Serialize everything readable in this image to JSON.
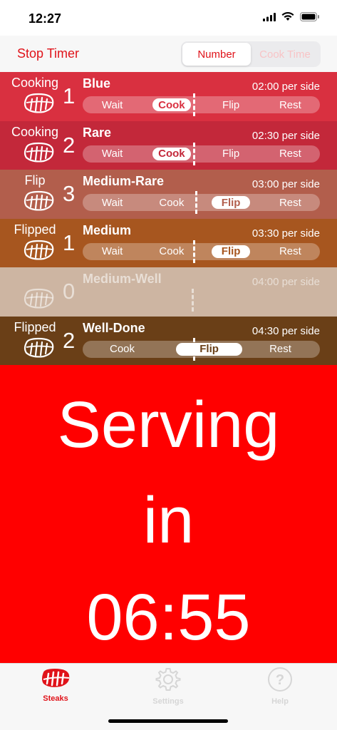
{
  "status_bar": {
    "time": "12:27"
  },
  "toolbar": {
    "stop_timer": "Stop Timer",
    "segments": [
      "Number",
      "Cook Time"
    ],
    "selected_segment": "Number"
  },
  "rows": [
    {
      "status": "Cooking",
      "count": "1",
      "name": "Blue",
      "time": "02:00 per side",
      "steps": [
        "Wait",
        "Cook",
        "Flip",
        "Rest"
      ],
      "active_step": "Cook",
      "color": "#d93040"
    },
    {
      "status": "Cooking",
      "count": "2",
      "name": "Rare",
      "time": "02:30 per side",
      "steps": [
        "Wait",
        "Cook",
        "Flip",
        "Rest"
      ],
      "active_step": "Cook",
      "color": "#c3283a"
    },
    {
      "status": "Flip",
      "count": "3",
      "name": "Medium-Rare",
      "time": "03:00 per side",
      "steps": [
        "Wait",
        "Cook",
        "Flip",
        "Rest"
      ],
      "active_step": "Flip",
      "color": "#b25e4c"
    },
    {
      "status": "Flipped",
      "count": "1",
      "name": "Medium",
      "time": "03:30 per side",
      "steps": [
        "Wait",
        "Cook",
        "Flip",
        "Rest"
      ],
      "active_step": "Flip",
      "color": "#a7561f"
    },
    {
      "status": "",
      "count": "0",
      "name": "Medium-Well",
      "time": "04:00 per side",
      "steps": [],
      "active_step": "",
      "color": "#cdb5a2"
    },
    {
      "status": "Flipped",
      "count": "2",
      "name": "Well-Done",
      "time": "04:30 per side",
      "steps": [
        "Cook",
        "Flip",
        "Rest"
      ],
      "active_step": "Flip",
      "color": "#6a3f17"
    }
  ],
  "serving": {
    "line1": "Serving",
    "line2": "in",
    "countdown": "06:55"
  },
  "tabs": [
    {
      "label": "Steaks",
      "icon": "steak-icon",
      "active": true
    },
    {
      "label": "Settings",
      "icon": "gear-icon",
      "active": false
    },
    {
      "label": "Help",
      "icon": "help-icon",
      "active": false
    }
  ],
  "colors": {
    "accent": "#e0131a",
    "serving_bg": "#ff0000"
  }
}
